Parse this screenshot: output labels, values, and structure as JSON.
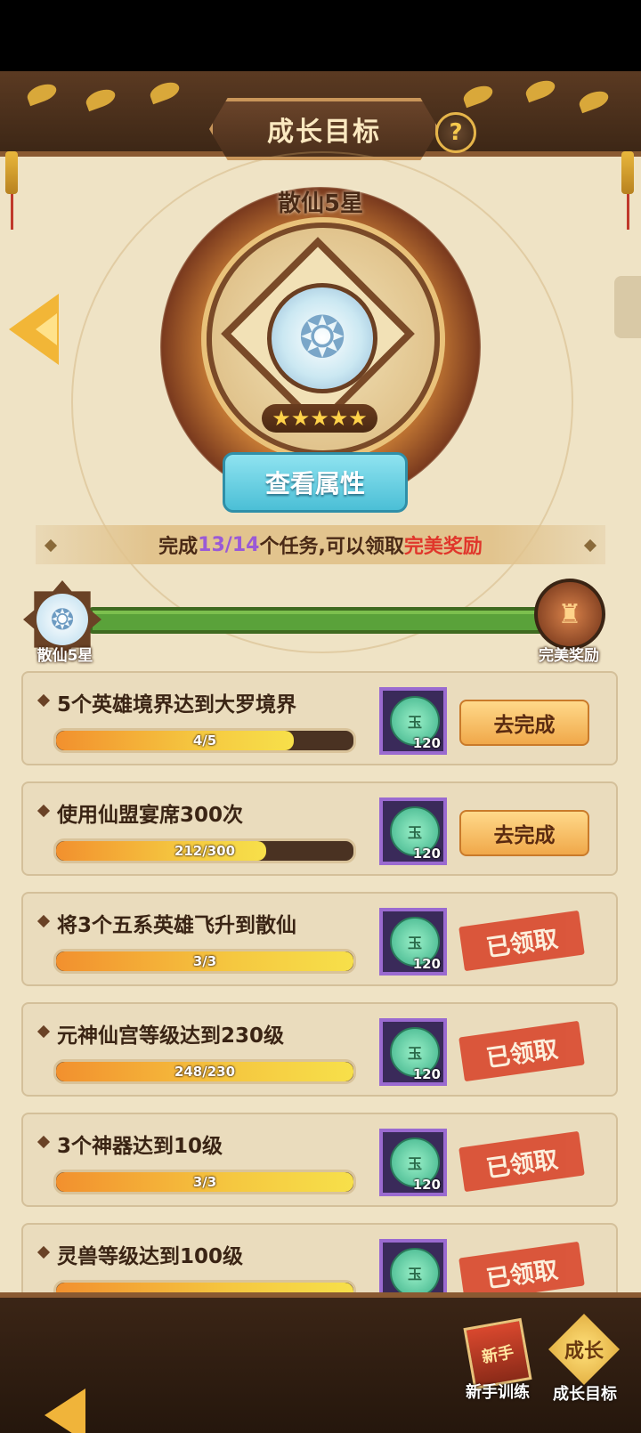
{
  "header": {
    "title": "成长目标",
    "help_label": "?"
  },
  "rank": {
    "name": "散仙5星",
    "stars": "★★★★★",
    "view_button": "查看属性"
  },
  "banner": {
    "prefix": "完成",
    "done": "13",
    "sep": "/",
    "total": "14",
    "mid": "个任务,可以领取",
    "reward": "完美奖励"
  },
  "progress": {
    "left_label": "散仙5星",
    "right_label": "完美奖励",
    "fraction": 1.0
  },
  "tasks": [
    {
      "name": "5个英雄境界达到大罗境界",
      "progress": "4/5",
      "fill": 0.8,
      "reward_amount": "120",
      "coin_label": "玉",
      "action": "去完成",
      "state": "todo"
    },
    {
      "name": "使用仙盟宴席300次",
      "progress": "212/300",
      "fill": 0.707,
      "reward_amount": "120",
      "coin_label": "玉",
      "action": "去完成",
      "state": "todo"
    },
    {
      "name": "将3个五系英雄飞升到散仙",
      "progress": "3/3",
      "fill": 1.0,
      "reward_amount": "120",
      "coin_label": "玉",
      "action": "已领取",
      "state": "claimed"
    },
    {
      "name": "元神仙宫等级达到230级",
      "progress": "248/230",
      "fill": 1.0,
      "reward_amount": "120",
      "coin_label": "玉",
      "action": "已领取",
      "state": "claimed"
    },
    {
      "name": "3个神器达到10级",
      "progress": "3/3",
      "fill": 1.0,
      "reward_amount": "120",
      "coin_label": "玉",
      "action": "已领取",
      "state": "claimed"
    },
    {
      "name": "灵兽等级达到100级",
      "progress": "",
      "fill": 1.0,
      "reward_amount": "",
      "coin_label": "玉",
      "action": "已领取",
      "state": "claimed"
    }
  ],
  "nav": {
    "training_label": "新手训练",
    "training_icon_text": "新手",
    "growth_label": "成长目标",
    "growth_icon_text": "成长"
  },
  "colors": {
    "accent_purple": "#9a5ad6",
    "accent_red": "#e0362b",
    "progress_green": "#5aa23a"
  }
}
